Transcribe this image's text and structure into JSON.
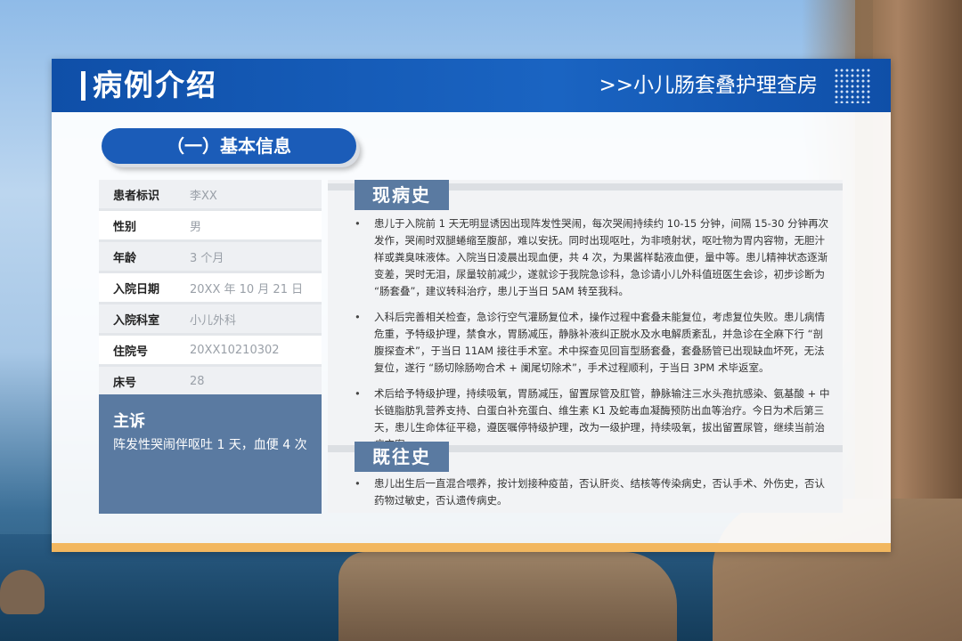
{
  "header": {
    "title": "病例介绍",
    "subtitle": ">>小儿肠套叠护理查房"
  },
  "basic_info": {
    "heading": "（一）基本信息",
    "rows": [
      {
        "key": "患者标识",
        "value": "李XX"
      },
      {
        "key": "性别",
        "value": "男"
      },
      {
        "key": "年龄",
        "value": "3 个月"
      },
      {
        "key": "入院日期",
        "value": "20XX 年 10 月 21 日"
      },
      {
        "key": "入院科室",
        "value": "小儿外科"
      },
      {
        "key": "住院号",
        "value": "20XX10210302"
      },
      {
        "key": "床号",
        "value": "28"
      }
    ]
  },
  "complaint": {
    "title": "主诉",
    "text": "阵发性哭闹伴呕吐 1 天，血便 4 次"
  },
  "present_history": {
    "title": "现病史",
    "items": [
      "患儿于入院前 1 天无明显诱因出现阵发性哭闹，每次哭闹持续约 10-15 分钟，间隔 15-30 分钟再次发作，哭闹时双腿蜷缩至腹部，难以安抚。同时出现呕吐，为非喷射状，呕吐物为胃内容物，无胆汁样或粪臭味液体。入院当日凌晨出现血便，共 4 次，为果酱样黏液血便，量中等。患儿精神状态逐渐变差，哭时无泪，尿量较前减少，遂就诊于我院急诊科，急诊请小儿外科值班医生会诊，初步诊断为 “肠套叠”，建议转科治疗，患儿于当日 5AM 转至我科。",
      "入科后完善相关检查，急诊行空气灌肠复位术，操作过程中套叠未能复位，考虑复位失败。患儿病情危重，予特级护理，禁食水，胃肠减压，静脉补液纠正脱水及水电解质紊乱，并急诊在全麻下行 “剖腹探查术”，于当日 11AM 接往手术室。术中探查见回盲型肠套叠，套叠肠管已出现缺血坏死，无法复位，遂行 “肠切除肠吻合术 + 阑尾切除术”，手术过程顺利，于当日 3PM 术毕返室。",
      "术后给予特级护理，持续吸氧，胃肠减压，留置尿管及肛管，静脉输注三水头孢抗感染、氨基酸 + 中长链脂肪乳营养支持、白蛋白补充蛋白、维生素 K1 及蛇毒血凝酶预防出血等治疗。今日为术后第三天，患儿生命体征平稳，遵医嘱停特级护理，改为一级护理，持续吸氧，拔出留置尿管，继续当前治疗方案。"
    ]
  },
  "past_history": {
    "title": "既往史",
    "items": [
      "患儿出生后一直混合喂养，按计划接种疫苗，否认肝炎、结核等传染病史，否认手术、外伤史，否认药物过敏史，否认遗传病史。"
    ]
  }
}
